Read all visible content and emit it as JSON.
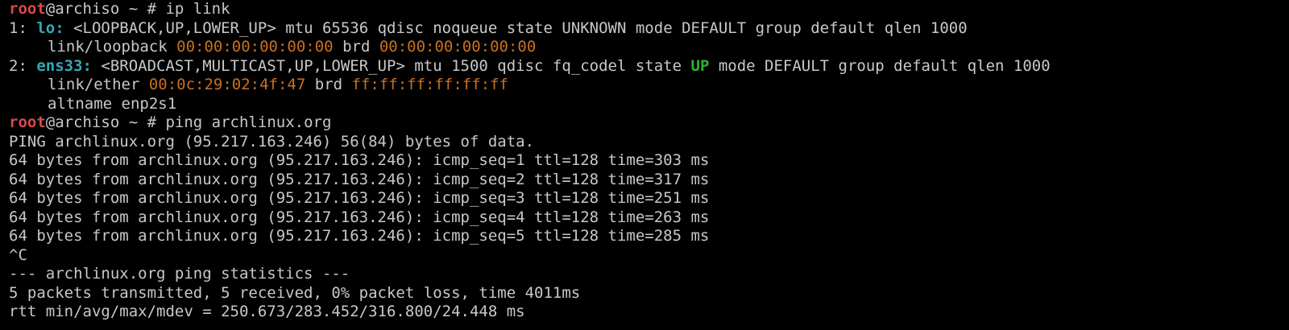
{
  "prompt": {
    "user": "root",
    "host_cwd": "@archiso ~ # "
  },
  "commands": {
    "ip_link": "ip link",
    "ping": "ping archlinux.org"
  },
  "ip_link_output": {
    "lo": {
      "index": "1: ",
      "name": "lo:",
      "flags": " <LOOPBACK,UP,LOWER_UP> mtu 65536 qdisc noqueue state UNKNOWN mode DEFAULT group default qlen 1000",
      "link_type": "link/loopback ",
      "mac": "00:00:00:00:00:00",
      "brd_label": " brd ",
      "brd": "00:00:00:00:00:00"
    },
    "ens33": {
      "index": "2: ",
      "name": "ens33:",
      "flags_before": " <BROADCAST,MULTICAST,UP,LOWER_UP> mtu 1500 qdisc fq_codel state ",
      "state": "UP",
      "flags_after": " mode DEFAULT group default qlen 1000",
      "link_type": "link/ether ",
      "mac": "00:0c:29:02:4f:47",
      "brd_label": " brd ",
      "brd": "ff:ff:ff:ff:ff:ff",
      "altname": "altname enp2s1"
    }
  },
  "ping_output": {
    "header": "PING archlinux.org (95.217.163.246) 56(84) bytes of data.",
    "replies": [
      "64 bytes from archlinux.org (95.217.163.246): icmp_seq=1 ttl=128 time=303 ms",
      "64 bytes from archlinux.org (95.217.163.246): icmp_seq=2 ttl=128 time=317 ms",
      "64 bytes from archlinux.org (95.217.163.246): icmp_seq=3 ttl=128 time=251 ms",
      "64 bytes from archlinux.org (95.217.163.246): icmp_seq=4 ttl=128 time=263 ms",
      "64 bytes from archlinux.org (95.217.163.246): icmp_seq=5 ttl=128 time=285 ms"
    ],
    "interrupt": "^C",
    "stats_header": "--- archlinux.org ping statistics ---",
    "stats_packets": "5 packets transmitted, 5 received, 0% packet loss, time 4011ms",
    "stats_rtt": "rtt min/avg/max/mdev = 250.673/283.452/316.800/24.448 ms"
  },
  "colors": {
    "background": "#000000",
    "text": "#c8c8c8",
    "prompt_user": "#d84a4a",
    "interface_name": "#36a7b8",
    "mac_address": "#c97020",
    "state_up": "#2fb12f"
  }
}
